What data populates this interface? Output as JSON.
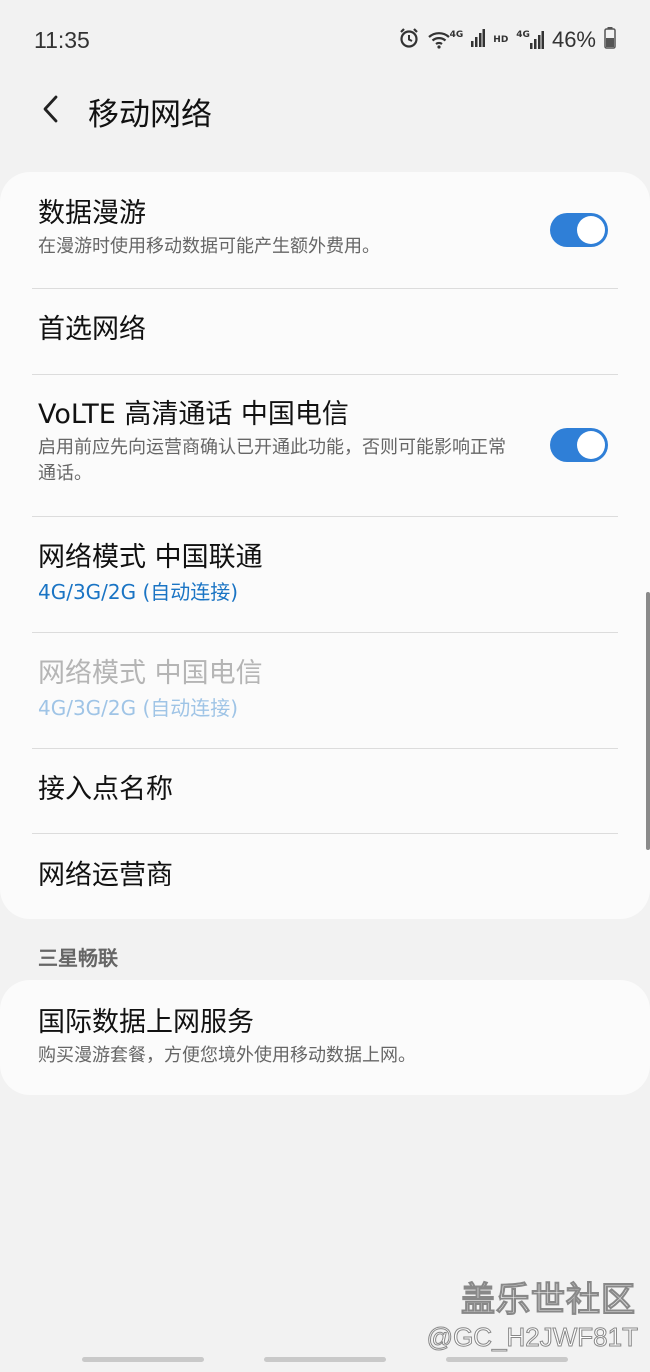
{
  "status_bar": {
    "time": "11:35",
    "wifi_network_label": "4G",
    "hd_label": "HD",
    "cell_network_label": "4G",
    "battery": "46%"
  },
  "header": {
    "title": "移动网络"
  },
  "settings": [
    {
      "title": "数据漫游",
      "subtitle": "在漫游时使用移动数据可能产生额外费用。",
      "toggle": true
    },
    {
      "title": "首选网络"
    },
    {
      "title": "VoLTE 高清通话 中国电信",
      "subtitle": "启用前应先向运营商确认已开通此功能，否则可能影响正常通话。",
      "toggle": true
    },
    {
      "title": "网络模式 中国联通",
      "subtitle": "4G/3G/2G (自动连接)"
    },
    {
      "title": "网络模式 中国电信",
      "subtitle": "4G/3G/2G (自动连接)",
      "disabled": true
    },
    {
      "title": "接入点名称"
    },
    {
      "title": "网络运营商"
    }
  ],
  "section": {
    "label": "三星畅联",
    "item": {
      "title": "国际数据上网服务",
      "subtitle": "购买漫游套餐，方便您境外使用移动数据上网。"
    }
  },
  "watermark": {
    "name": "盖乐世社区",
    "user": "@GC_H2JWF81T"
  },
  "colors": {
    "accent": "#2f7fd7",
    "link_blue": "#1a74c4",
    "background": "#f2f2f2",
    "card": "#fbfbfb"
  }
}
